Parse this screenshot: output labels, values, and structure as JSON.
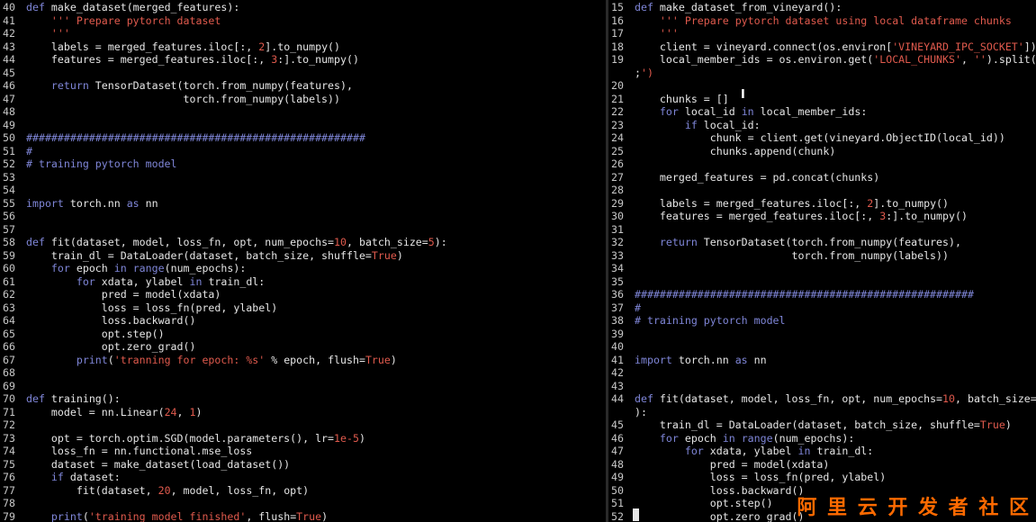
{
  "watermark": "阿 里 云 开 发 者 社 区",
  "left_pane": [
    {
      "n": "40",
      "t": "def make_dataset(merged_features):"
    },
    {
      "n": "41",
      "t": "    ''' Prepare pytorch dataset"
    },
    {
      "n": "42",
      "t": "    '''"
    },
    {
      "n": "43",
      "t": "    labels = merged_features.iloc[:, 2].to_numpy()"
    },
    {
      "n": "44",
      "t": "    features = merged_features.iloc[:, 3:].to_numpy()"
    },
    {
      "n": "45",
      "t": ""
    },
    {
      "n": "46",
      "t": "    return TensorDataset(torch.from_numpy(features),"
    },
    {
      "n": "47",
      "t": "                         torch.from_numpy(labels))"
    },
    {
      "n": "48",
      "t": ""
    },
    {
      "n": "49",
      "t": ""
    },
    {
      "n": "50",
      "t": "######################################################"
    },
    {
      "n": "51",
      "t": "#"
    },
    {
      "n": "52",
      "t": "# training pytorch model"
    },
    {
      "n": "53",
      "t": ""
    },
    {
      "n": "54",
      "t": ""
    },
    {
      "n": "55",
      "t": "import torch.nn as nn"
    },
    {
      "n": "56",
      "t": ""
    },
    {
      "n": "57",
      "t": ""
    },
    {
      "n": "58",
      "t": "def fit(dataset, model, loss_fn, opt, num_epochs=10, batch_size=5):"
    },
    {
      "n": "59",
      "t": "    train_dl = DataLoader(dataset, batch_size, shuffle=True)"
    },
    {
      "n": "60",
      "t": "    for epoch in range(num_epochs):"
    },
    {
      "n": "61",
      "t": "        for xdata, ylabel in train_dl:"
    },
    {
      "n": "62",
      "t": "            pred = model(xdata)"
    },
    {
      "n": "63",
      "t": "            loss = loss_fn(pred, ylabel)"
    },
    {
      "n": "64",
      "t": "            loss.backward()"
    },
    {
      "n": "65",
      "t": "            opt.step()"
    },
    {
      "n": "66",
      "t": "            opt.zero_grad()"
    },
    {
      "n": "67",
      "t": "        print('tranning for epoch: %s' % epoch, flush=True)"
    },
    {
      "n": "68",
      "t": ""
    },
    {
      "n": "69",
      "t": ""
    },
    {
      "n": "70",
      "t": "def training():"
    },
    {
      "n": "71",
      "t": "    model = nn.Linear(24, 1)"
    },
    {
      "n": "72",
      "t": ""
    },
    {
      "n": "73",
      "t": "    opt = torch.optim.SGD(model.parameters(), lr=1e-5)"
    },
    {
      "n": "74",
      "t": "    loss_fn = nn.functional.mse_loss"
    },
    {
      "n": "75",
      "t": "    dataset = make_dataset(load_dataset())"
    },
    {
      "n": "76",
      "t": "    if dataset:"
    },
    {
      "n": "77",
      "t": "        fit(dataset, 20, model, loss_fn, opt)"
    },
    {
      "n": "78",
      "t": ""
    },
    {
      "n": "79",
      "t": "    print('training model finished', flush=True)"
    }
  ],
  "right_pane": [
    {
      "n": "15",
      "t": "def make_dataset_from_vineyard():"
    },
    {
      "n": "16",
      "t": "    ''' Prepare pytorch dataset using local dataframe chunks"
    },
    {
      "n": "17",
      "t": "    '''"
    },
    {
      "n": "18",
      "t": "    client = vineyard.connect(os.environ['VINEYARD_IPC_SOCKET'])"
    },
    {
      "n": "19",
      "t": "    local_member_ids = os.environ.get('LOCAL_CHUNKS', '').split('"
    },
    {
      "n": "",
      "t": ";')"
    },
    {
      "n": "20",
      "t": ""
    },
    {
      "n": "21",
      "t": "    chunks = []"
    },
    {
      "n": "22",
      "t": "    for local_id in local_member_ids:"
    },
    {
      "n": "23",
      "t": "        if local_id:"
    },
    {
      "n": "24",
      "t": "            chunk = client.get(vineyard.ObjectID(local_id))"
    },
    {
      "n": "25",
      "t": "            chunks.append(chunk)"
    },
    {
      "n": "26",
      "t": ""
    },
    {
      "n": "27",
      "t": "    merged_features = pd.concat(chunks)"
    },
    {
      "n": "28",
      "t": ""
    },
    {
      "n": "29",
      "t": "    labels = merged_features.iloc[:, 2].to_numpy()"
    },
    {
      "n": "30",
      "t": "    features = merged_features.iloc[:, 3:].to_numpy()"
    },
    {
      "n": "31",
      "t": ""
    },
    {
      "n": "32",
      "t": "    return TensorDataset(torch.from_numpy(features),"
    },
    {
      "n": "33",
      "t": "                         torch.from_numpy(labels))"
    },
    {
      "n": "34",
      "t": ""
    },
    {
      "n": "35",
      "t": ""
    },
    {
      "n": "36",
      "t": "######################################################"
    },
    {
      "n": "37",
      "t": "#"
    },
    {
      "n": "38",
      "t": "# training pytorch model"
    },
    {
      "n": "39",
      "t": ""
    },
    {
      "n": "40",
      "t": ""
    },
    {
      "n": "41",
      "t": "import torch.nn as nn"
    },
    {
      "n": "42",
      "t": ""
    },
    {
      "n": "43",
      "t": ""
    },
    {
      "n": "44",
      "t": "def fit(dataset, model, loss_fn, opt, num_epochs=10, batch_size=5"
    },
    {
      "n": "",
      "t": "):"
    },
    {
      "n": "45",
      "t": "    train_dl = DataLoader(dataset, batch_size, shuffle=True)"
    },
    {
      "n": "46",
      "t": "    for epoch in range(num_epochs):"
    },
    {
      "n": "47",
      "t": "        for xdata, ylabel in train_dl:"
    },
    {
      "n": "48",
      "t": "            pred = model(xdata)"
    },
    {
      "n": "49",
      "t": "            loss = loss_fn(pred, ylabel)"
    },
    {
      "n": "50",
      "t": "            loss.backward()"
    },
    {
      "n": "51",
      "t": "            opt.step()"
    },
    {
      "n": "52",
      "t": "            opt.zero_grad()"
    }
  ]
}
